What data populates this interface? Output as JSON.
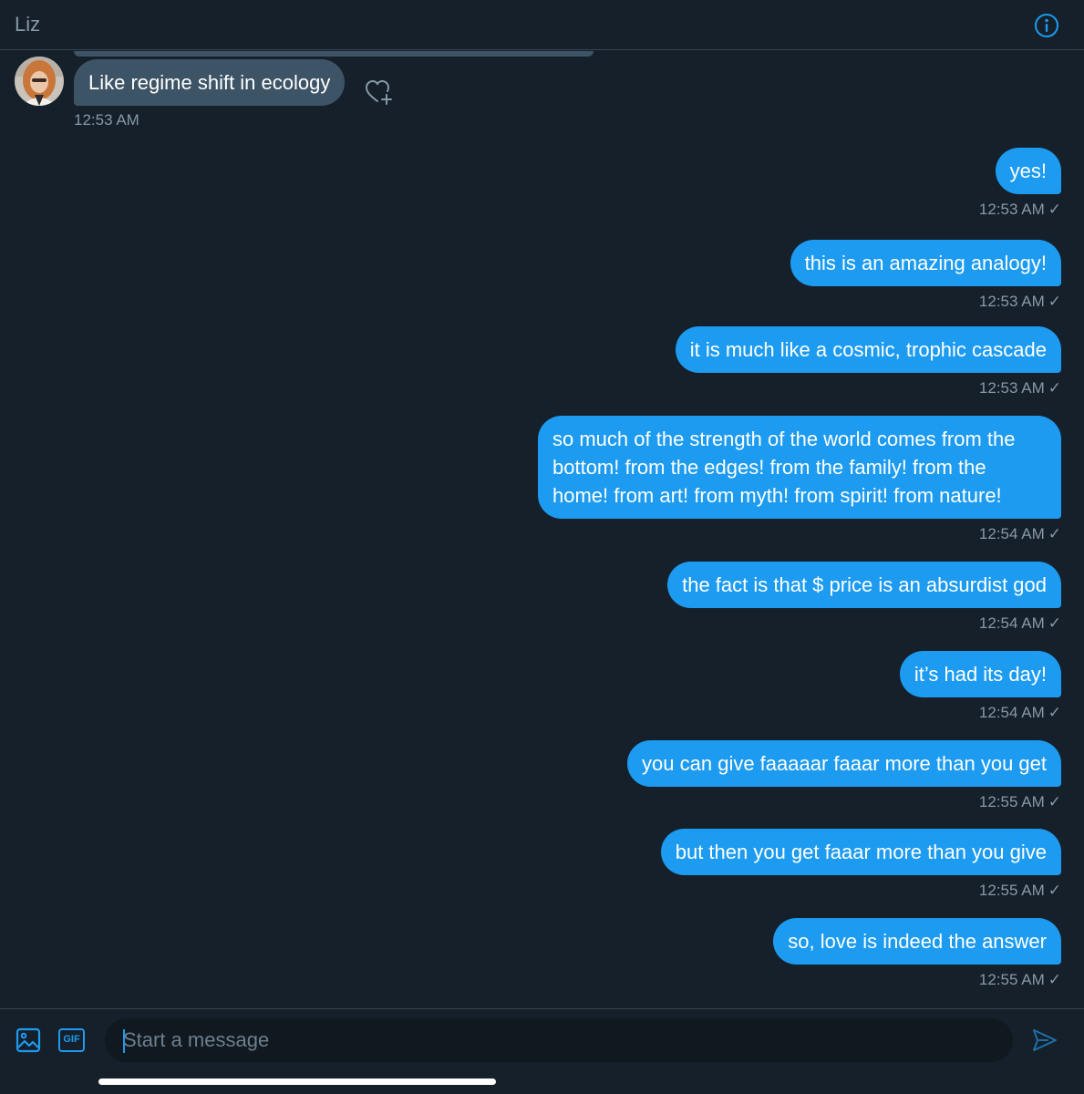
{
  "header": {
    "title": "Liz",
    "info_icon": "info-icon"
  },
  "incoming": {
    "text": "Like regime shift in ecology",
    "time": "12:53 AM",
    "react_icon": "heart-add-icon"
  },
  "outgoing": [
    {
      "text": "yes!",
      "time": "12:53 AM"
    },
    {
      "text": "this is an amazing analogy!",
      "time": "12:53 AM"
    },
    {
      "text": "it is much like a cosmic, trophic cascade",
      "time": "12:53 AM"
    },
    {
      "text": "so much of the strength of the world comes from the bottom! from the edges! from the family! from the home! from art! from myth! from spirit! from nature!",
      "time": "12:54 AM"
    },
    {
      "text": "the fact is that $ price is an absurdist god",
      "time": "12:54 AM"
    },
    {
      "text": "it’s had its day!",
      "time": "12:54 AM"
    },
    {
      "text": "you can give faaaaar faaar more than you get",
      "time": "12:55 AM"
    },
    {
      "text": "but then you get faaar more than you give",
      "time": "12:55 AM"
    },
    {
      "text": "so, love is indeed the answer",
      "time": "12:55 AM"
    }
  ],
  "read_check": "✓",
  "composer": {
    "placeholder": "Start a message",
    "gif_label": "GIF",
    "media_icon": "image-icon",
    "send_icon": "send-icon"
  },
  "colors": {
    "background": "#15202b",
    "accent": "#1d9bf0",
    "incoming_bubble": "#3d5466",
    "muted_text": "#8899a6"
  }
}
